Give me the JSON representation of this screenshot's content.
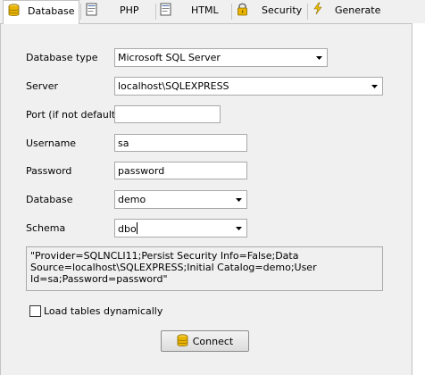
{
  "tabs": [
    {
      "label": "Database",
      "icon": "database-icon",
      "active": true
    },
    {
      "label": "PHP",
      "icon": "php-file-icon",
      "active": false
    },
    {
      "label": "HTML",
      "icon": "html-file-icon",
      "active": false
    },
    {
      "label": "Security",
      "icon": "padlock-icon",
      "active": false
    },
    {
      "label": "Generate",
      "icon": "lightning-icon",
      "active": false
    }
  ],
  "form": {
    "database_type": {
      "label": "Database type",
      "value": "Microsoft SQL Server"
    },
    "server": {
      "label": "Server",
      "value": "localhost\\SQLEXPRESS"
    },
    "port": {
      "label": "Port (if not default)",
      "value": ""
    },
    "username": {
      "label": "Username",
      "value": "sa"
    },
    "password": {
      "label": "Password",
      "value": "password"
    },
    "database": {
      "label": "Database",
      "value": "demo"
    },
    "schema": {
      "label": "Schema",
      "value": "dbo"
    }
  },
  "connection_string": "\"Provider=SQLNCLI11;Persist Security Info=False;Data Source=localhost\\SQLEXPRESS;Initial Catalog=demo;User Id=sa;Password=password\"",
  "load_tables": {
    "label": "Load tables dynamically",
    "checked": false
  },
  "connect_button": {
    "label": "Connect",
    "icon": "database-icon"
  },
  "colors": {
    "panel_bg": "#f0f0f0",
    "field_border": "#a9a9a9",
    "icon_gold": "#e8b400"
  }
}
